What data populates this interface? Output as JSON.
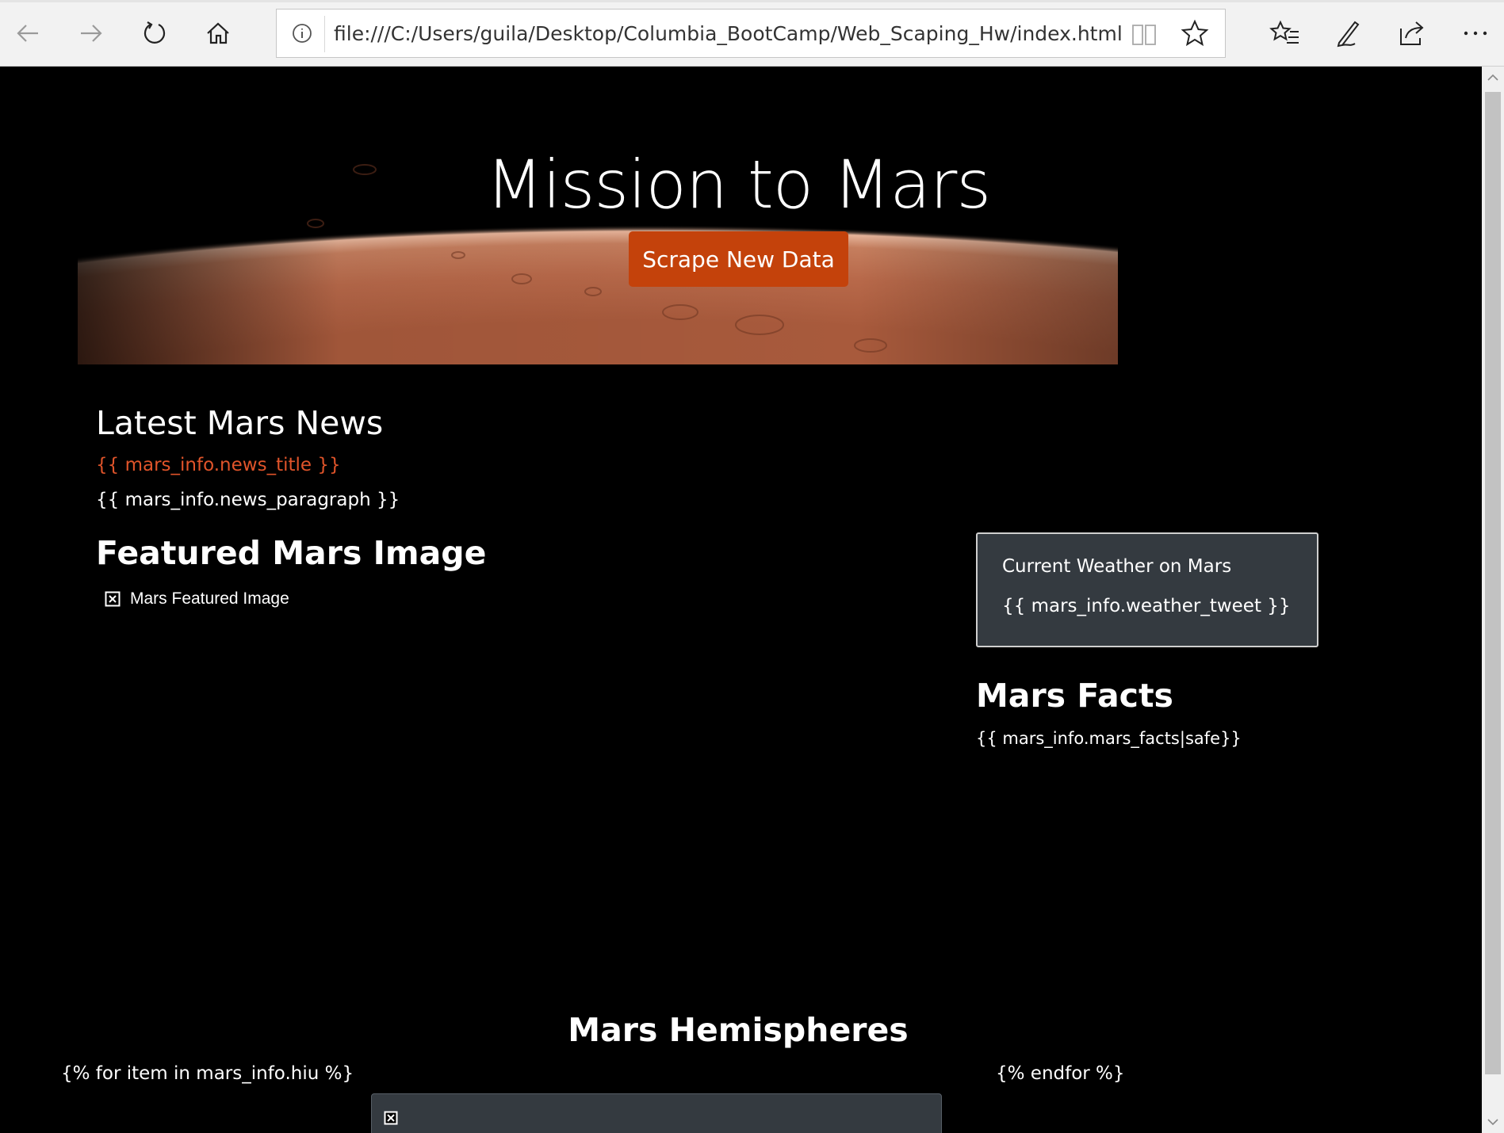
{
  "browser": {
    "url": "file:///C:/Users/guila/Desktop/Columbia_BootCamp/Web_Scaping_Hw/index.html",
    "icons": [
      "back-icon",
      "forward-icon",
      "refresh-icon",
      "home-icon",
      "info-icon",
      "reading-view-icon",
      "favorite-star-icon",
      "favorites-list-icon",
      "pen-icon",
      "share-icon",
      "more-icon"
    ]
  },
  "hero": {
    "title": "Mission to Mars",
    "button_label": "Scrape New Data",
    "button_color": "#c4420b"
  },
  "news": {
    "heading": "Latest Mars News",
    "title": "{{ mars_info.news_title }}",
    "paragraph": "{{ mars_info.news_paragraph }}",
    "title_color": "#e0542a"
  },
  "featured": {
    "heading": "Featured Mars Image",
    "alt_text": "Mars Featured Image"
  },
  "weather": {
    "title": "Current Weather on Mars",
    "tweet": "{{ mars_info.weather_tweet }}",
    "card_color": "#343a40"
  },
  "facts": {
    "heading": "Mars Facts",
    "body": "{{ mars_info.mars_facts|safe}}"
  },
  "hemispheres": {
    "heading": "Mars Hemispheres",
    "for_tag": "{% for item in mars_info.hiu %}",
    "endfor_tag": "{% endfor %}"
  }
}
